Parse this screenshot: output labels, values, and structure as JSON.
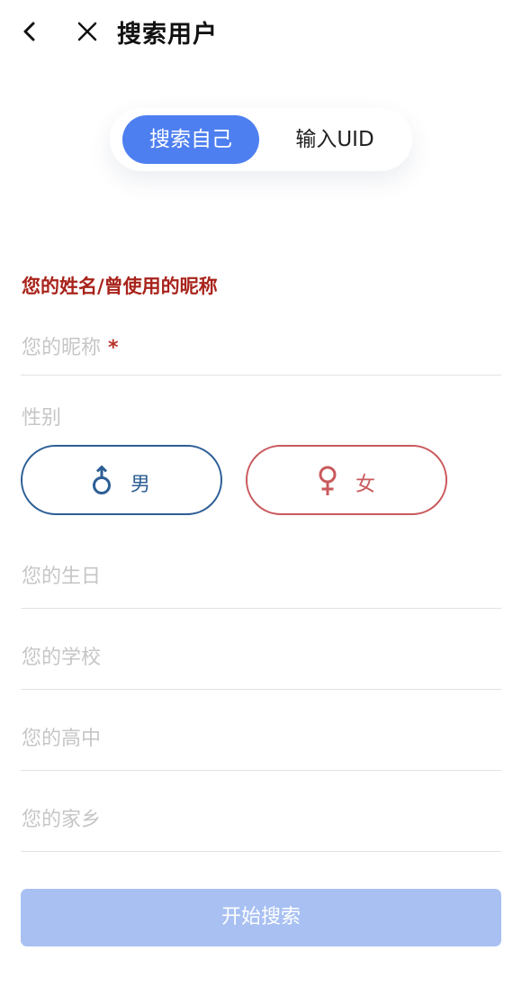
{
  "nav": {
    "back_icon": "chevron-left-icon",
    "close_icon": "close-icon",
    "title": "搜索用户"
  },
  "tabs": [
    {
      "label": "搜索自己",
      "active": true
    },
    {
      "label": "输入UID",
      "active": false
    }
  ],
  "form": {
    "section_label": "您的姓名/曾使用的昵称",
    "nickname": {
      "placeholder": "您的昵称",
      "required_mark": "*"
    },
    "gender": {
      "label": "性别",
      "male": {
        "label": "男",
        "icon": "male-symbol-icon"
      },
      "female": {
        "label": "女",
        "icon": "female-symbol-icon"
      }
    },
    "birthday": {
      "placeholder": "您的生日"
    },
    "school": {
      "placeholder": "您的学校"
    },
    "high_school": {
      "placeholder": "您的高中"
    },
    "hometown": {
      "placeholder": "您的家乡"
    }
  },
  "search_button": {
    "label": "开始搜索"
  },
  "colors": {
    "accent": "#4e7ff0",
    "button_disabled": "#a8c0f2",
    "section_label": "#a8231b",
    "male": "#2c5e95",
    "female": "#c9595c",
    "placeholder": "#c6c6c6"
  }
}
